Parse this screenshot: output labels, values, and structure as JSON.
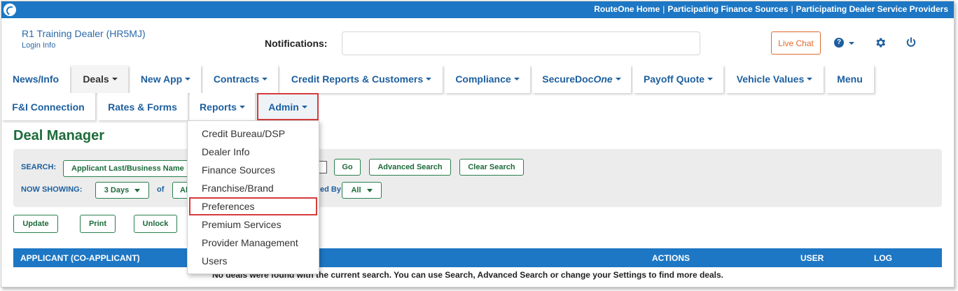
{
  "topbar": {
    "links": [
      "RouteOne Home",
      "Participating Finance Sources",
      "Participating Dealer Service Providers"
    ],
    "separator": "|"
  },
  "header": {
    "dealer_name": "R1 Training Dealer (HR5MJ)",
    "login_info": "Login Info",
    "notifications_label": "Notifications:",
    "live_chat": "Live Chat",
    "help_glyph": "?"
  },
  "nav": {
    "row1": [
      {
        "label": "News/Info",
        "caret": false
      },
      {
        "label": "Deals",
        "caret": true
      },
      {
        "label": "New App",
        "caret": true
      },
      {
        "label": "Contracts",
        "caret": true
      },
      {
        "label": "Credit Reports & Customers",
        "caret": true
      },
      {
        "label": "Compliance",
        "caret": true
      },
      {
        "label": "SecureDoc",
        "italic": "One",
        "caret": true
      },
      {
        "label": "Payoff Quote",
        "caret": true
      },
      {
        "label": "Vehicle Values",
        "caret": true
      },
      {
        "label": "Menu",
        "caret": false
      }
    ],
    "row2": [
      {
        "label": "F&I Connection",
        "caret": false
      },
      {
        "label": "Rates & Forms",
        "caret": false
      },
      {
        "label": "Reports",
        "caret": true
      },
      {
        "label": "Admin",
        "caret": true
      }
    ]
  },
  "admin_menu": {
    "items": [
      "Credit Bureau/DSP",
      "Dealer Info",
      "Finance Sources",
      "Franchise/Brand",
      "Preferences",
      "Premium Services",
      "Provider Management",
      "Users"
    ],
    "highlighted": "Preferences"
  },
  "main": {
    "title": "Deal Manager",
    "search_label": "SEARCH:",
    "search_field": "Applicant Last/Business Name",
    "go": "Go",
    "advanced_search": "Advanced Search",
    "clear_search": "Clear Search",
    "now_showing_label": "NOW SHOWING:",
    "days": "3 Days",
    "of_label": "of",
    "of_value_partial": "Al",
    "by_label_partial": "ed By",
    "by_value": "All",
    "update": "Update",
    "print": "Print",
    "unlock": "Unlock"
  },
  "table": {
    "headers": [
      "APPLICANT (CO-APPLICANT)",
      "ACTIONS",
      "USER",
      "LOG"
    ],
    "empty_message": "No deals were found with the current search. You can use Search, Advanced Search or change your Settings to find more deals."
  },
  "colors": {
    "topbar": "#1d77c4",
    "nav_text": "#1d5f9e",
    "title_green": "#1d6b3a",
    "button_border": "#2a7f4d",
    "highlight_red": "#d63b3b",
    "live_chat": "#e06a2b"
  }
}
